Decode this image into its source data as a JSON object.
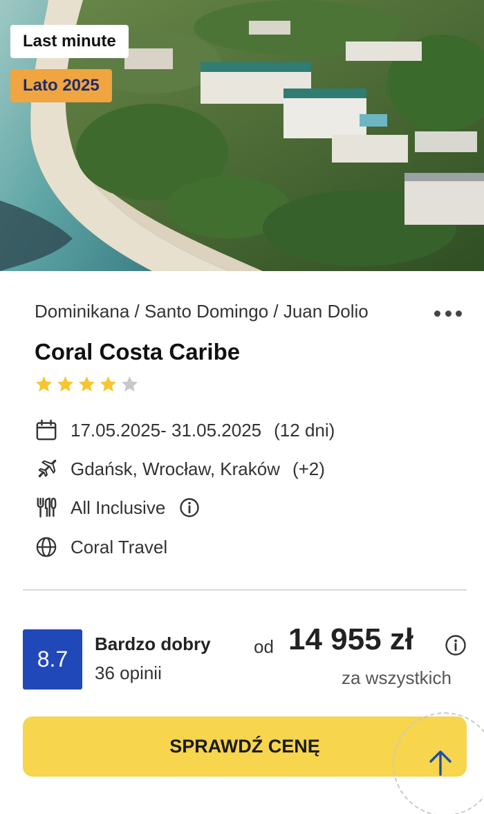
{
  "hero": {
    "badge_offer": "Last minute",
    "badge_season": "Lato 2025",
    "badge_season_color": "#f0a540"
  },
  "icons": {
    "favorite": "heart-outline-icon",
    "more": "ellipsis-horizontal-icon",
    "date": "calendar-icon",
    "flight": "airplane-icon",
    "board": "cutlery-icon",
    "operator": "globe-icon",
    "info": "info-circle-icon",
    "scroll_top": "arrow-up-icon"
  },
  "location": {
    "breadcrumb": "Dominikana / Santo Domingo / Juan Dolio"
  },
  "hotel": {
    "name": "Coral Costa Caribe",
    "stars": 4,
    "max_stars": 5
  },
  "details": {
    "dates": "17.05.2025- 31.05.2025",
    "duration": "(12 dni)",
    "departures": "Gdańsk, Wrocław, Kraków",
    "departures_more": "(+2)",
    "board": "All Inclusive",
    "operator": "Coral Travel"
  },
  "rating": {
    "score": "8.7",
    "label": "Bardzo dobry",
    "reviews": "36 opinii",
    "color": "#2048b8"
  },
  "price": {
    "prefix": "od",
    "amount": "14 955 zł",
    "note": "za wszystkich"
  },
  "cta": {
    "label": "SPRAWDŹ CENĘ",
    "color": "#f7d54c"
  }
}
